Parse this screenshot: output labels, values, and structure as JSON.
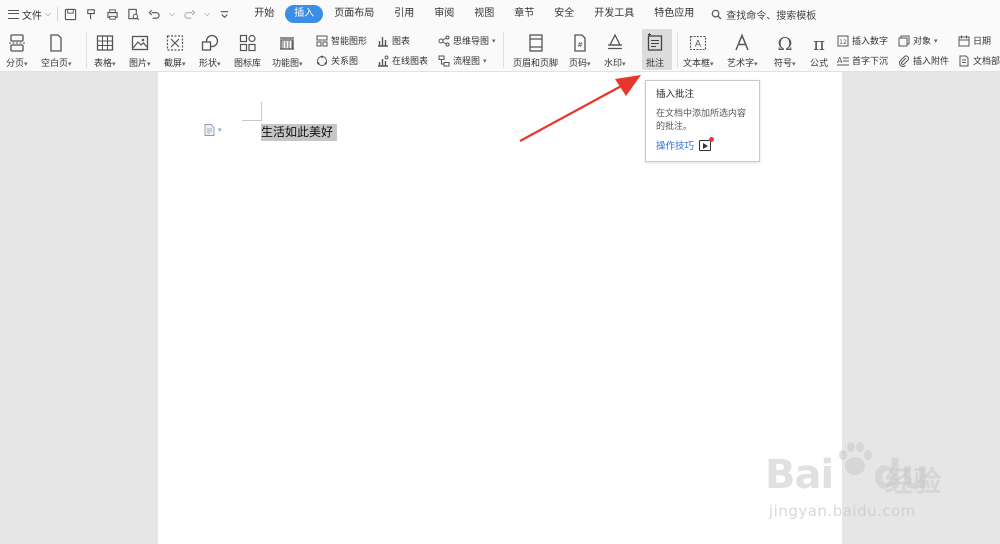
{
  "window": {
    "file_label": "文件",
    "tabs": [
      "开始",
      "插入",
      "页面布局",
      "引用",
      "审阅",
      "视图",
      "章节",
      "安全",
      "开发工具",
      "特色应用"
    ],
    "active_tab": "插入",
    "search_label": "查找命令、搜索模板"
  },
  "ribbon": {
    "fenye": "分页",
    "kongbaiye": "空白页",
    "biaoge": "表格",
    "tupian": "图片",
    "jieping": "截屏",
    "xingzhuang": "形状",
    "tubiaoku": "图标库",
    "gongnengtu": "功能图",
    "zhinengtuxing": "智能图形",
    "tubiao": "图表",
    "siweidaotu": "思维导图",
    "guanxitu": "关系图",
    "zaixiantubiao": "在线图表",
    "liuchengtu": "流程图",
    "yemeiheyejiao": "页眉和页脚",
    "yema": "页码",
    "shuiyin": "水印",
    "pizhu": "批注",
    "wenbenkuang": "文本框",
    "yishuzi": "艺术字",
    "fuhao": "符号",
    "gongshi": "公式",
    "charushuzi": "插入数字",
    "duixiang": "对象",
    "riqi": "日期",
    "shouzixiachen": "首字下沉",
    "charufujian": "插入附件",
    "wendangbu": "文档部"
  },
  "document": {
    "text": "生活如此美好"
  },
  "tooltip": {
    "title": "插入批注",
    "description": "在文档中添加所选内容的批注。",
    "link": "操作技巧"
  },
  "watermark": {
    "brand": "Bai",
    "brand2": "du",
    "cn": "经验",
    "url": "jingyan.baidu.com"
  },
  "colors": {
    "accent": "#3a8ee6",
    "arrow": "#e8362c",
    "link": "#2f6fd6"
  }
}
